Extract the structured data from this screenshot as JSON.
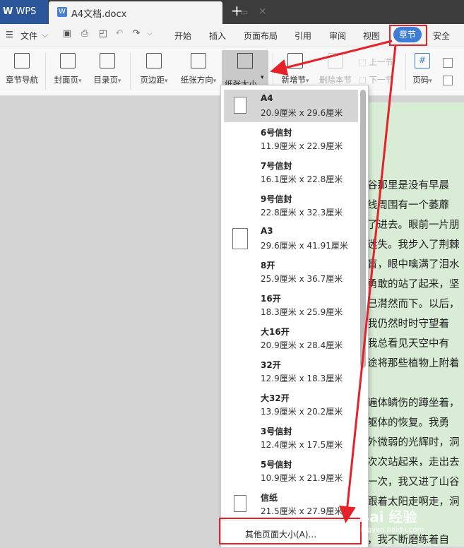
{
  "titlebar": {
    "app_label": "WPS",
    "doc_name": "A4文档.docx"
  },
  "menubar": {
    "file_label": "文件",
    "tabs": [
      "开始",
      "插入",
      "页面布局",
      "引用",
      "审阅",
      "视图",
      "章节",
      "安全"
    ]
  },
  "ribbon": {
    "chapter_nav": "章节导航",
    "cover": "封面页",
    "toc": "目录页",
    "margins": "页边距",
    "orientation": "纸张方向",
    "paper_size": "纸张大小",
    "new_section": "新增节",
    "delete_section": "删除本节",
    "prev_section": "上一节",
    "next_section": "下一节",
    "page_number": "页码",
    "page_number_icon_text": "#"
  },
  "dropdown": {
    "items": [
      {
        "name": "A4",
        "width": "20.9厘米",
        "height": "29.6厘米"
      },
      {
        "name": "6号信封",
        "width": "11.9厘米",
        "height": "22.9厘米"
      },
      {
        "name": "7号信封",
        "width": "16.1厘米",
        "height": "22.8厘米"
      },
      {
        "name": "9号信封",
        "width": "22.8厘米",
        "height": "32.3厘米"
      },
      {
        "name": "A3",
        "width": "29.6厘米",
        "height": "41.91厘米"
      },
      {
        "name": "8开",
        "width": "25.9厘米",
        "height": "36.7厘米"
      },
      {
        "name": "16开",
        "width": "18.3厘米",
        "height": "25.9厘米"
      },
      {
        "name": "大16开",
        "width": "20.9厘米",
        "height": "28.4厘米"
      },
      {
        "name": "32开",
        "width": "12.9厘米",
        "height": "18.3厘米"
      },
      {
        "name": "大32开",
        "width": "13.9厘米",
        "height": "20.2厘米"
      },
      {
        "name": "3号信封",
        "width": "12.4厘米",
        "height": "17.5厘米"
      },
      {
        "name": "5号信封",
        "width": "10.9厘米",
        "height": "21.9厘米"
      },
      {
        "name": "信纸",
        "width": "21.5厘米",
        "height": "27.9厘米"
      }
    ],
    "times": "x",
    "other_label": "其他页面大小(A)..."
  },
  "document": {
    "lines": [
      "谷那里是没有早晨",
      "线周围有一个萎蘼",
      "了进去。眼前一片朋",
      "迷失。我步入了荆棘",
      "盲，眼中噙满了泪水",
      "勇敢的站了起来，坚",
      "已潸然而下。以后，",
      "  我仍然时时守望着",
      "  我总看见天空中有",
      "途将那些植物上附着",
      "遍体鳞伤的蹲坐着，",
      "  躯体的恢复。我勇",
      "外微弱的光辉时，洞",
      "次次站起来，走出去",
      "一次，我又进了山谷",
      "跟着太阳走啊走，洞",
      "，我不断磨练着自"
    ]
  },
  "watermark": {
    "brand": "Bai 经验",
    "url": "jingyan.baidu.com"
  }
}
